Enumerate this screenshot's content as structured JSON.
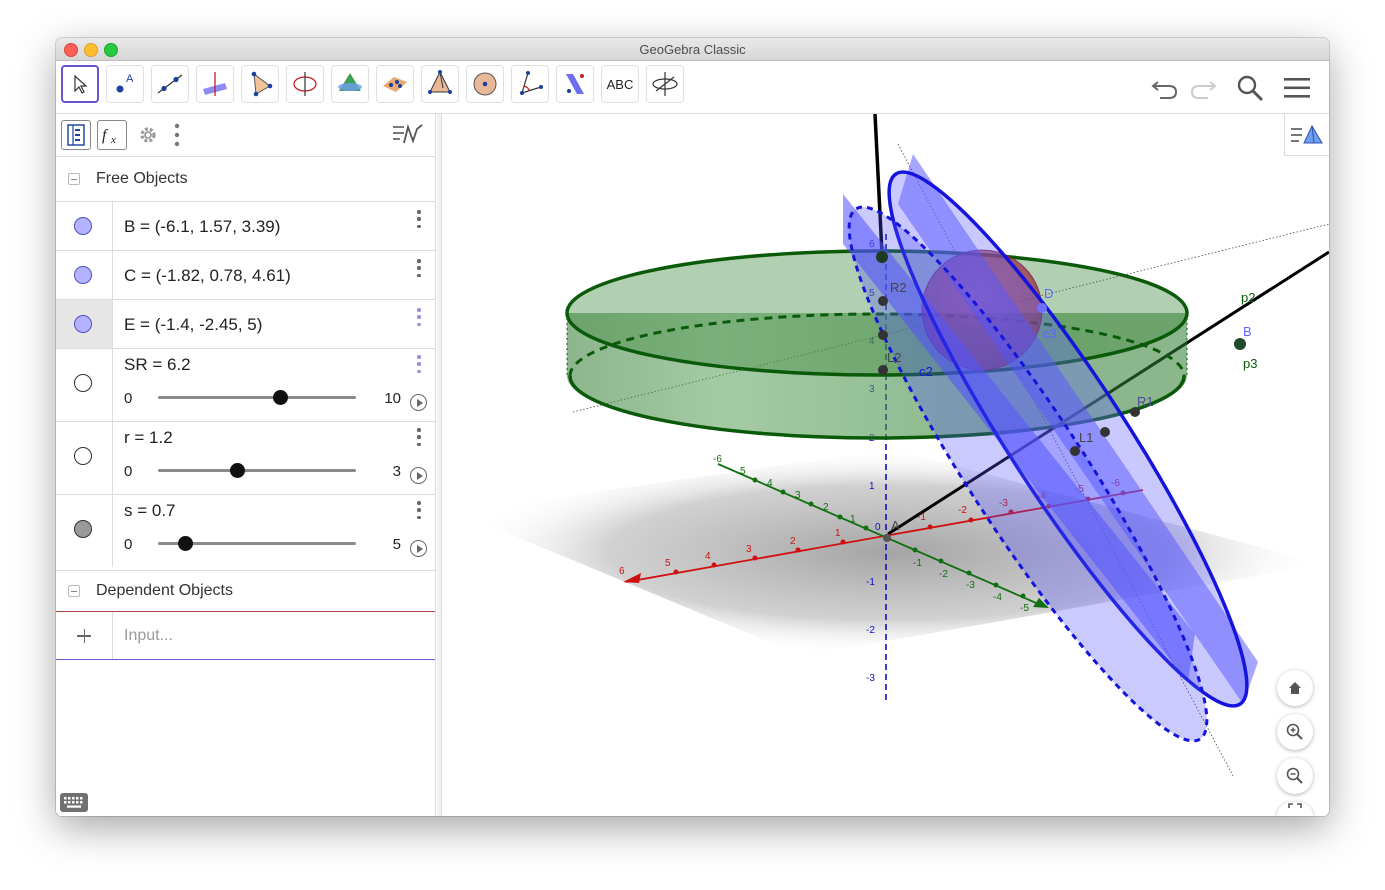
{
  "window": {
    "title": "GeoGebra Classic"
  },
  "toolbar": {
    "tools": [
      {
        "icon": "move-arrow-icon"
      },
      {
        "icon": "point-icon"
      },
      {
        "icon": "line-icon"
      },
      {
        "icon": "perpendicular-line-icon"
      },
      {
        "icon": "polygon-icon"
      },
      {
        "icon": "circle-axis-icon"
      },
      {
        "icon": "intersect-surfaces-icon"
      },
      {
        "icon": "plane-points-icon"
      },
      {
        "icon": "pyramid-icon"
      },
      {
        "icon": "sphere-icon"
      },
      {
        "icon": "angle-icon"
      },
      {
        "icon": "reflect-plane-icon"
      },
      {
        "icon": "text-tool-icon",
        "label": "ABC"
      },
      {
        "icon": "rotate-view-icon"
      }
    ],
    "undo": "undo-icon",
    "redo": "redo-icon",
    "search": "search-icon",
    "menu": "menu-icon"
  },
  "algebra": {
    "free_objects_label": "Free Objects",
    "dependent_objects_label": "Dependent Objects",
    "items": [
      {
        "text": "B = (-6.1, 1.57, 3.39)",
        "color": "#b3b3ff"
      },
      {
        "text": "C = (-1.82, 0.78, 4.61)",
        "color": "#b3b3ff"
      },
      {
        "text": "E = (-1.4, -2.45, 5)",
        "color": "#b3b3ff"
      }
    ],
    "sliders": [
      {
        "text": "SR = 6.2",
        "min": "0",
        "max": "10",
        "fraction": 0.62,
        "dot_color": "#ffffff"
      },
      {
        "text": "r = 1.2",
        "min": "0",
        "max": "3",
        "fraction": 0.4,
        "dot_color": "#ffffff"
      },
      {
        "text": "s = 0.7",
        "min": "0",
        "max": "5",
        "fraction": 0.14,
        "dot_color": "#9a9a9a"
      }
    ],
    "input_placeholder": "Input..."
  },
  "graphics": {
    "z_ticks": [
      "6",
      "5",
      "4",
      "3",
      "2",
      "1",
      "0",
      "-1",
      "-2",
      "-3"
    ],
    "x_ticks": [
      "6",
      "5",
      "4",
      "3",
      "2",
      "1",
      "-1",
      "-2",
      "-3",
      "-4",
      "-5",
      "-6"
    ],
    "y_ticks": [
      "-6",
      "5",
      "4",
      "3",
      "2",
      "1",
      "-1",
      "-2",
      "-3",
      "-4",
      "-5"
    ],
    "labels": {
      "R2": "R2",
      "L2": "L2",
      "R1": "R1",
      "L1": "L1",
      "p2": "p2",
      "p3": "p3",
      "B": "B",
      "A": "A",
      "D": "D",
      "E": "E",
      "G": "G",
      "c2": "c2",
      "c3": "c3"
    }
  },
  "colors": {
    "accent": "#6557d2",
    "blue_surface": "#5050ff",
    "green_surface": "#4a8a4a",
    "x_axis": "#d01010",
    "y_axis": "#107010",
    "z_axis": "#1010c0"
  }
}
